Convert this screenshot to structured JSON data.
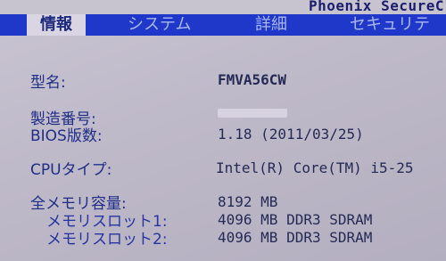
{
  "header": {
    "vendor": "Phoenix SecureC"
  },
  "tabs": [
    {
      "label": "情報",
      "active": true
    },
    {
      "label": "システム",
      "active": false
    },
    {
      "label": "詳細",
      "active": false
    },
    {
      "label": "セキュリテ",
      "active": false
    }
  ],
  "info": {
    "model_label": "型名:",
    "model_value": "FMVA56CW",
    "serial_label": "製造番号:",
    "bios_label": "BIOS版数:",
    "bios_value": "1.18 (2011/03/25)",
    "cpu_label": "CPUタイプ:",
    "cpu_value": "Intel(R) Core(TM) i5-25",
    "memory_label": "全メモリ容量:",
    "memory_value": "8192 MB",
    "slot1_label": "メモリスロット1:",
    "slot1_value": "4096 MB DDR3 SDRAM",
    "slot2_label": "メモリスロット2:",
    "slot2_value": "4096 MB DDR3 SDRAM"
  },
  "colors": {
    "tab_bar": "#1f38c9",
    "active_tab": "#d9d5e2",
    "background": "#c4bfcf",
    "label_text": "#1f2d86"
  }
}
